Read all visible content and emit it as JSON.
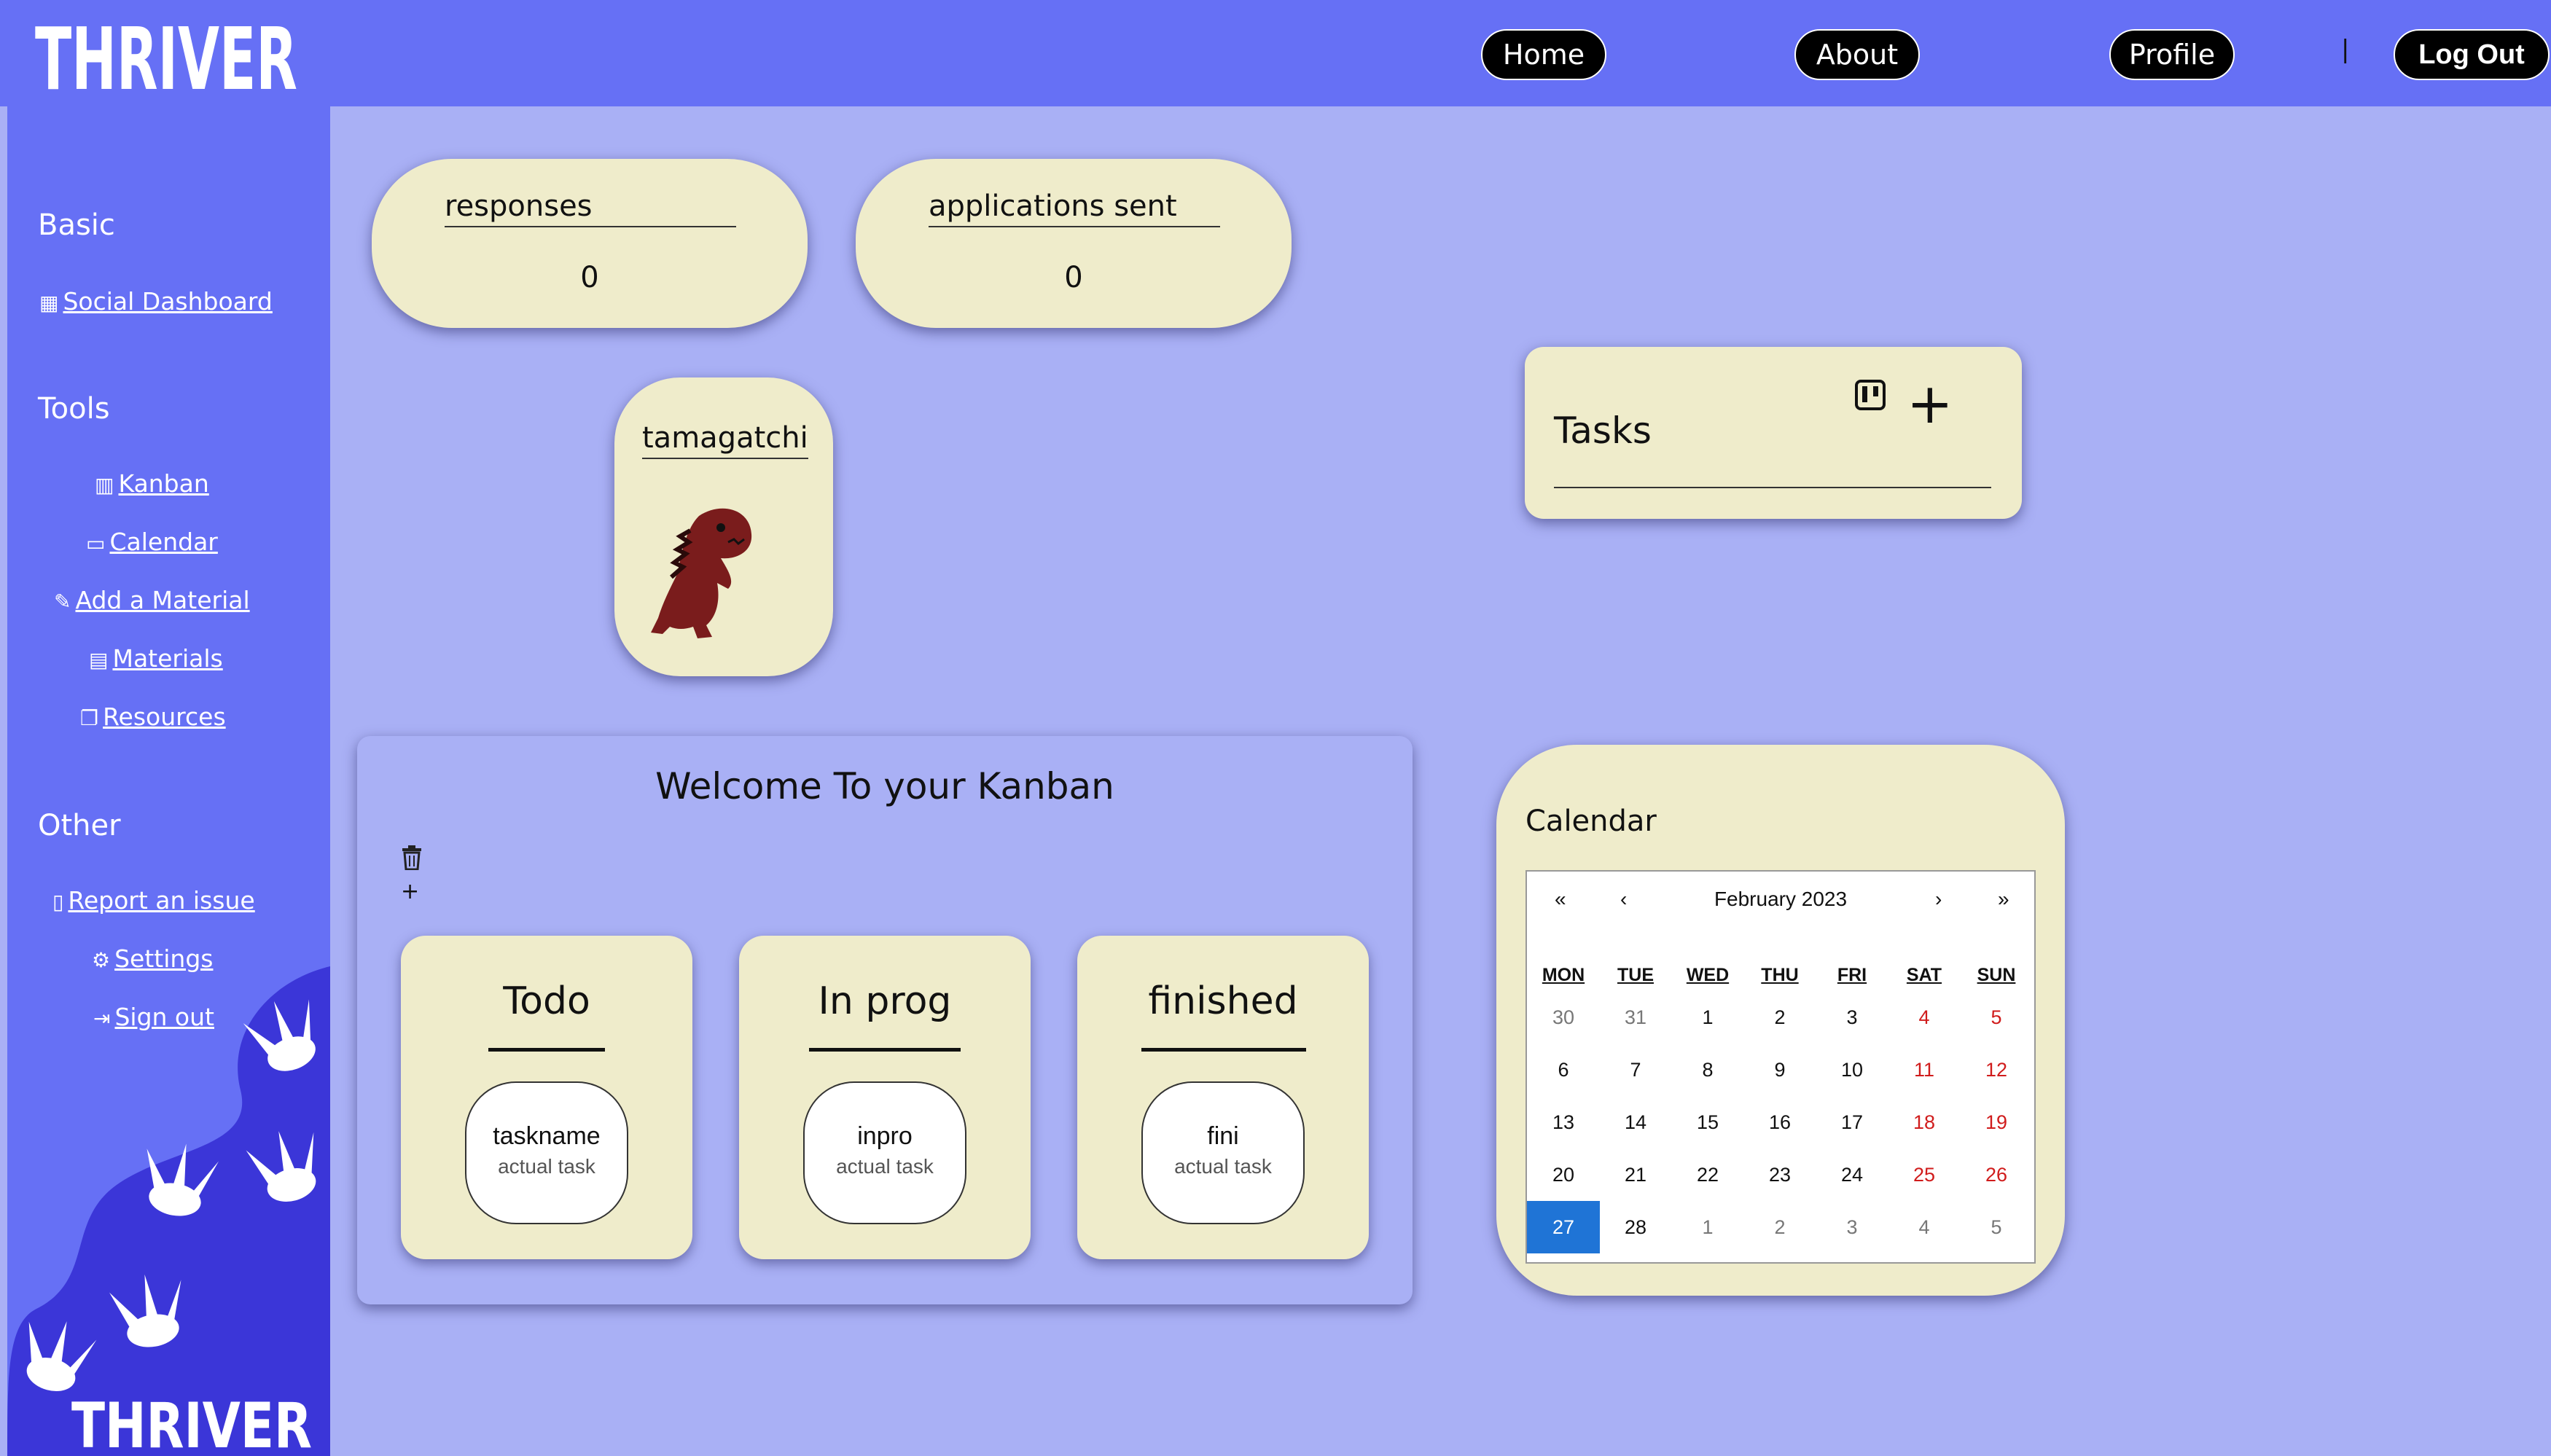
{
  "app": {
    "logo_text": "THRIVER"
  },
  "nav": {
    "home": "Home",
    "about": "About",
    "profile": "Profile",
    "separator": "|",
    "logout": "Log Out"
  },
  "sidebar": {
    "basic_heading": "Basic",
    "social_dashboard": "Social Dashboard",
    "tools_heading": "Tools",
    "kanban": "Kanban",
    "calendar": "Calendar",
    "add_material": "Add a Material",
    "materials": "Materials",
    "resources": "Resources",
    "other_heading": "Other",
    "report_issue": "Report an issue",
    "settings": "Settings",
    "sign_out": "Sign out",
    "bottom_logo": "THRIVER"
  },
  "stats": {
    "responses_label": "responses",
    "responses_value": "0",
    "applications_label": "applications sent",
    "applications_value": "0"
  },
  "tamagatchi": {
    "label": "tamagatchi"
  },
  "tasks": {
    "title": "Tasks",
    "add_symbol": "+"
  },
  "kanban": {
    "heading": "Welcome To your Kanban",
    "add_symbol": "+",
    "columns": [
      {
        "title": "Todo",
        "task_name": "taskname",
        "task_desc": "actual task"
      },
      {
        "title": "In prog",
        "task_name": "inpro",
        "task_desc": "actual task"
      },
      {
        "title": "finished",
        "task_name": "fini",
        "task_desc": "actual task"
      }
    ]
  },
  "calendar": {
    "title": "Calendar",
    "month": "February 2023",
    "nav": {
      "prev_year": "«",
      "prev": "‹",
      "next": "›",
      "next_year": "»"
    },
    "weekdays": [
      "MON",
      "TUE",
      "WED",
      "THU",
      "FRI",
      "SAT",
      "SUN"
    ],
    "weeks": [
      [
        "30",
        "31",
        "1",
        "2",
        "3",
        "4",
        "5"
      ],
      [
        "6",
        "7",
        "8",
        "9",
        "10",
        "11",
        "12"
      ],
      [
        "13",
        "14",
        "15",
        "16",
        "17",
        "18",
        "19"
      ],
      [
        "20",
        "21",
        "22",
        "23",
        "24",
        "25",
        "26"
      ],
      [
        "27",
        "28",
        "1",
        "2",
        "3",
        "4",
        "5"
      ]
    ],
    "selected_day": "27",
    "colors": {
      "weekend": "#d01c1c",
      "selected": "#1f74d6",
      "other_month": "#777777"
    }
  },
  "theme": {
    "nav_bg": "#6670f5",
    "page_bg": "#a9b0f5",
    "card_bg": "#efeccb",
    "blob": "#3b36d8"
  }
}
